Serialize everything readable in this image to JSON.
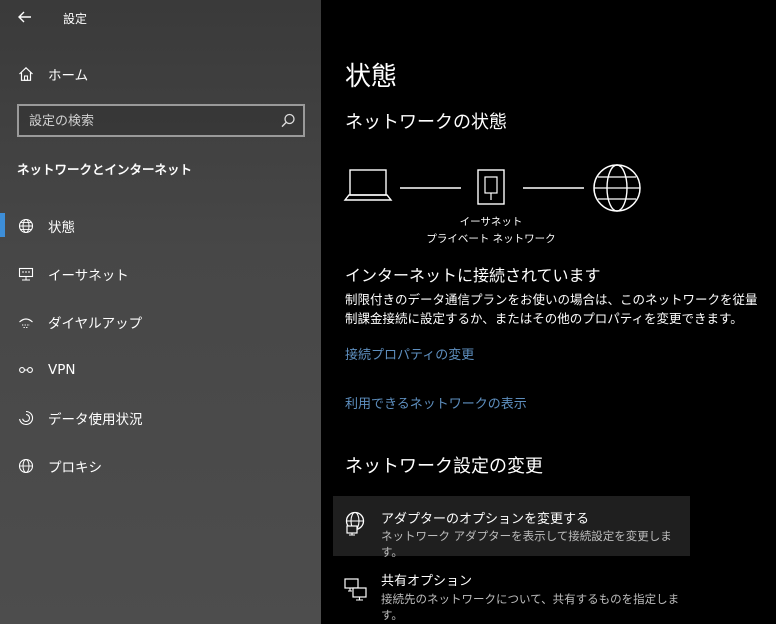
{
  "window": {
    "title": "設定"
  },
  "sidebar": {
    "home_label": "ホーム",
    "search_placeholder": "設定の検索",
    "section_title": "ネットワークとインターネット",
    "items": [
      {
        "label": "状態",
        "icon": "globe-icon",
        "selected": true
      },
      {
        "label": "イーサネット",
        "icon": "ethernet-icon"
      },
      {
        "label": "ダイヤルアップ",
        "icon": "dialup-icon"
      },
      {
        "label": "VPN",
        "icon": "vpn-icon"
      },
      {
        "label": "データ使用状況",
        "icon": "data-usage-icon"
      },
      {
        "label": "プロキシ",
        "icon": "proxy-globe-icon"
      }
    ]
  },
  "main": {
    "page_title": "状態",
    "network_status_heading": "ネットワークの状態",
    "diagram": {
      "adapter_name": "イーサネット",
      "network_name": "プライベート ネットワーク"
    },
    "connected_heading": "インターネットに接続されています",
    "connected_description": "制限付きのデータ通信プランをお使いの場合は、このネットワークを従量制課金接続に設定するか、またはその他のプロパティを変更できます。",
    "links": {
      "properties": "接続プロパティの変更",
      "available_networks": "利用できるネットワークの表示"
    },
    "change_heading": "ネットワーク設定の変更",
    "options": [
      {
        "title": "アダプターのオプションを変更する",
        "description": "ネットワーク アダプターを表示して接続設定を変更します。",
        "icon": "adapter-icon"
      },
      {
        "title": "共有オプション",
        "description": "接続先のネットワークについて、共有するものを指定します。",
        "icon": "sharing-icon"
      }
    ]
  },
  "colors": {
    "accent": "#3d8ed8",
    "link": "#5e8fbf"
  }
}
